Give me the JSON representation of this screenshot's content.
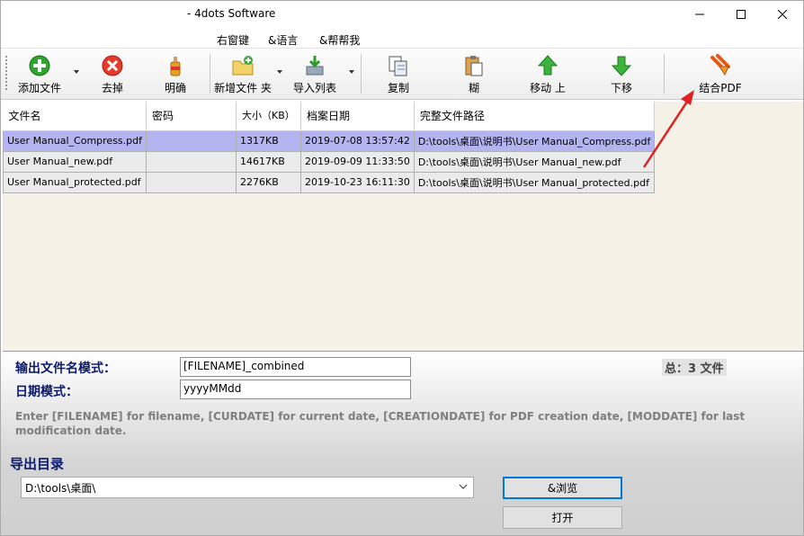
{
  "window": {
    "title": "- 4dots Software"
  },
  "menu": {
    "items": [
      "右窗键",
      "&语言",
      "&帮帮我"
    ]
  },
  "toolbar": {
    "add": "添加文件",
    "remove": "去掉",
    "clear": "明确",
    "add_folder": "新增文件 夹",
    "import_list": "导入列表",
    "copy": "复制",
    "paste": "糊",
    "move_up": "移动 上",
    "move_down": "下移",
    "join": "结合PDF"
  },
  "table": {
    "headers": [
      "文件名",
      "密码",
      "大小（KB）",
      "档案日期",
      "完整文件路径"
    ],
    "rows": [
      [
        "User Manual_Compress.pdf",
        "",
        "1317KB",
        "2019-07-08 13:57:42",
        "D:\\tools\\桌面\\说明书\\User Manual_Compress.pdf"
      ],
      [
        "User Manual_new.pdf",
        "",
        "14617KB",
        "2019-09-09 11:33:50",
        "D:\\tools\\桌面\\说明书\\User Manual_new.pdf"
      ],
      [
        "User Manual_protected.pdf",
        "",
        "2276KB",
        "2019-10-23 16:11:30",
        "D:\\tools\\桌面\\说明书\\User Manual_protected.pdf"
      ]
    ]
  },
  "output": {
    "pattern_label": "输出文件名模式：",
    "pattern_value": "[FILENAME]_combined",
    "date_label": "日期模式：",
    "date_value": "yyyyMMdd",
    "hint": "Enter [FILENAME] for filename, [CURDATE] for current date, [CREATIONDATE] for PDF creation date, [MODDATE] for last modification date.",
    "total": "总：3 文件",
    "dir_label": "导出目录",
    "dir_value": "D:\\tools\\桌面\\",
    "browse": "&浏览",
    "open": "打开"
  },
  "colors": {
    "selected_row": "#b4b4f0",
    "label_blue": "#0a1a6e",
    "annotation_red": "#e02020"
  }
}
